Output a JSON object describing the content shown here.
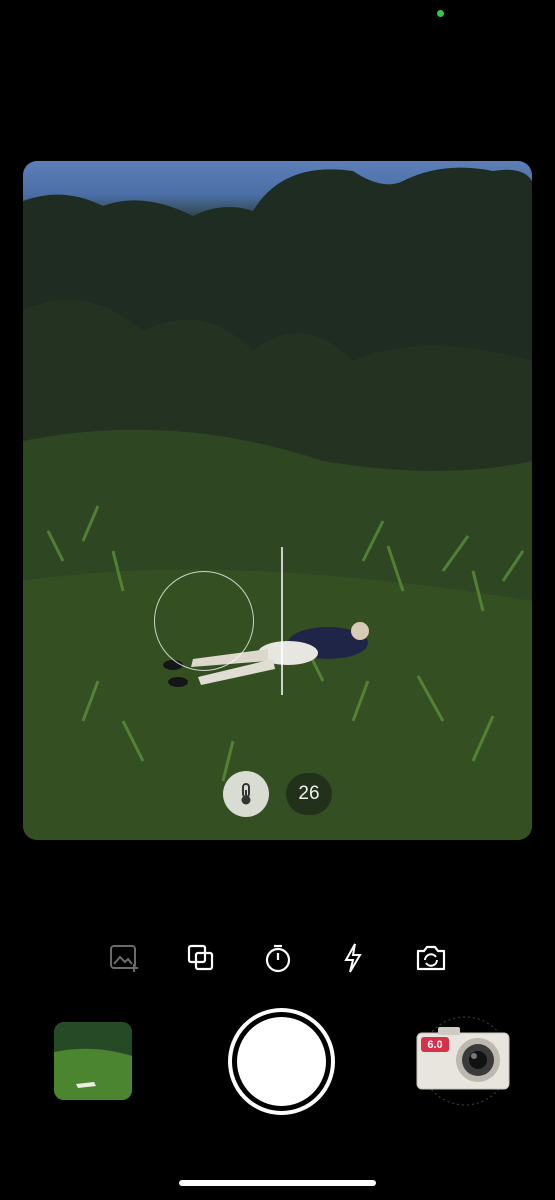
{
  "viewfinder": {
    "exposure_value": "26"
  },
  "toolbar": {
    "icons": [
      "gallery-add-icon",
      "layers-icon",
      "timer-icon",
      "flash-icon",
      "flip-camera-icon"
    ]
  },
  "camera_badge": "6.0",
  "colors": {
    "status_dot": "#2ecc40",
    "camera_badge": "#d6304a"
  }
}
